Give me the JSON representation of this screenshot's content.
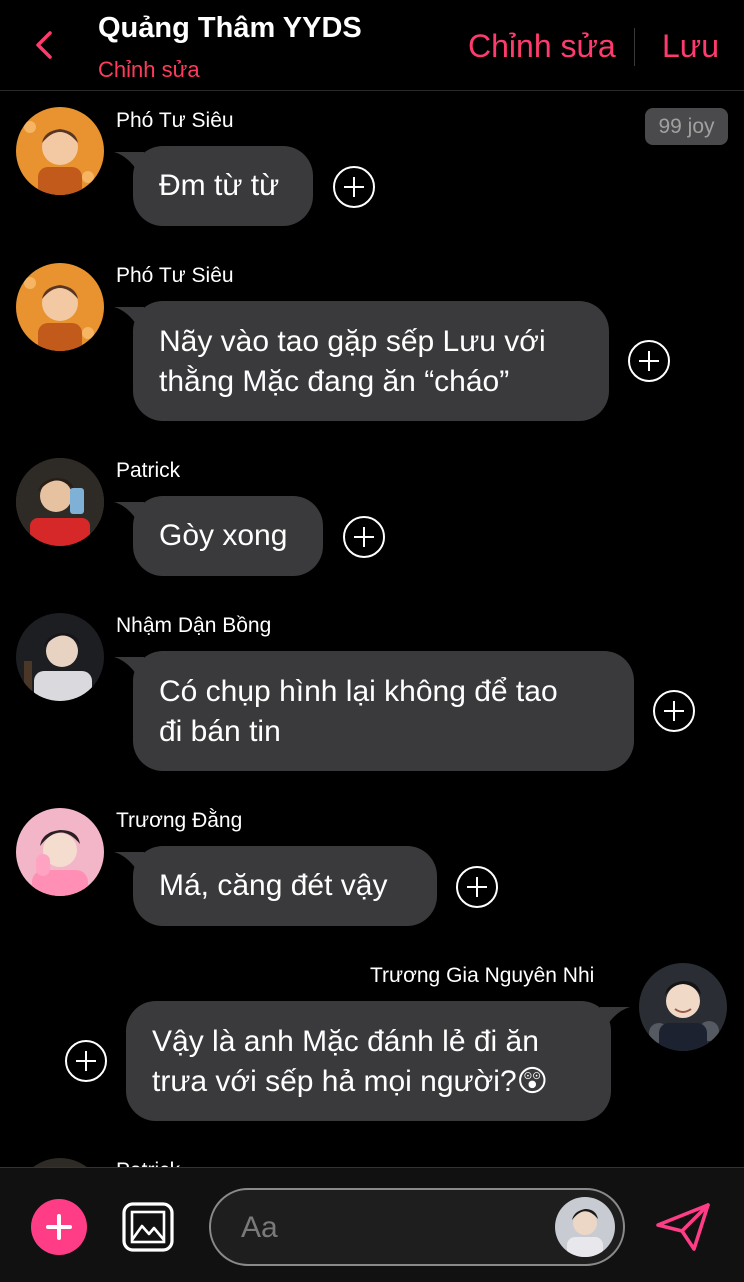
{
  "header": {
    "title": "Quảng Thâm YYDS",
    "subtitle": "Chỉnh sửa",
    "edit_label": "Chỉnh sửa",
    "save_label": "Lưu"
  },
  "badge": {
    "label": "99 joy"
  },
  "messages": [
    {
      "sender": "Phó Tư Siêu",
      "lines": [
        "Đm từ từ"
      ]
    },
    {
      "sender": "Phó Tư Siêu",
      "lines": [
        "Nãy vào tao gặp sếp Lưu với",
        "thằng Mặc đang ăn “cháo”"
      ]
    },
    {
      "sender": "Patrick",
      "lines": [
        "Gòy xong"
      ]
    },
    {
      "sender": "Nhậm Dận Bồng",
      "lines": [
        "Có chụp hình lại không để tao",
        "đi bán tin"
      ]
    },
    {
      "sender": "Trương Đằng",
      "lines": [
        "Má, căng đét vậy"
      ]
    },
    {
      "sender": "Trương Gia Nguyên Nhi",
      "lines": [
        "Vậy là anh Mặc đánh lẻ đi ăn",
        "trưa với sếp hả mọi người?😲"
      ],
      "outgoing": true
    },
    {
      "sender": "Patrick",
      "lines": []
    }
  ],
  "composer": {
    "placeholder": "Aa"
  },
  "colors": {
    "accent": "#ff3b6e",
    "bubble": "#3a3a3c",
    "fab": "#ff3d86"
  }
}
